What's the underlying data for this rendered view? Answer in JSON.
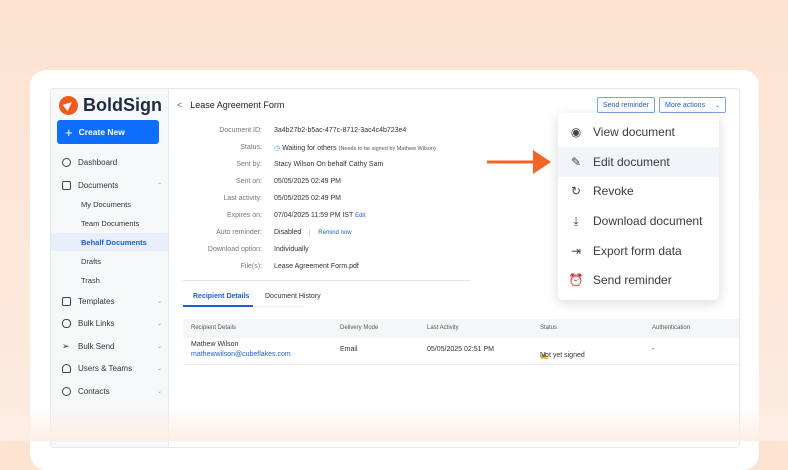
{
  "brand": {
    "name": "BoldSign",
    "accent": "#f25a1d",
    "primary": "#0d6efd"
  },
  "sidebar": {
    "create": "Create New",
    "items": [
      {
        "label": "Dashboard",
        "icon": "dashboard-icon"
      },
      {
        "label": "Documents",
        "icon": "folder-icon"
      },
      {
        "label": "My Documents"
      },
      {
        "label": "Team Documents"
      },
      {
        "label": "Behalf Documents"
      },
      {
        "label": "Drafts"
      },
      {
        "label": "Trash"
      },
      {
        "label": "Templates",
        "icon": "templates-icon"
      },
      {
        "label": "Bulk Links",
        "icon": "link-icon"
      },
      {
        "label": "Bulk Send",
        "icon": "send-icon"
      },
      {
        "label": "Users & Teams",
        "icon": "users-icon"
      },
      {
        "label": "Contacts",
        "icon": "contacts-icon"
      }
    ]
  },
  "header": {
    "title": "Lease Agreement Form",
    "send_reminder": "Send reminder",
    "more_actions": "More actions"
  },
  "details": [
    {
      "label": "Document ID:",
      "value": "3a4b27b2-b5ac-477c-8712-3ac4c4b723e4"
    },
    {
      "label": "Status:",
      "value": "Waiting for others",
      "note": "(Needs to be signed by Mathew Wilson)"
    },
    {
      "label": "Sent by:",
      "value": "Stacy Wilson On behalf Cathy Sam"
    },
    {
      "label": "Sent on:",
      "value": "05/05/2025 02:49 PM"
    },
    {
      "label": "Last activity:",
      "value": "05/05/2025 02:49 PM"
    },
    {
      "label": "Expires on:",
      "value": "07/04/2025 11:59 PM IST",
      "link": "Edit"
    },
    {
      "label": "Auto reminder:",
      "value": "Disabled",
      "link": "Remind now"
    },
    {
      "label": "Download option:",
      "value": "Individually"
    },
    {
      "label": "File(s):",
      "value": "Lease Agreement Form.pdf"
    }
  ],
  "tabs": [
    "Recipient Details",
    "Document History"
  ],
  "table": {
    "headers": [
      "Recipient Details",
      "Delivery Mode",
      "Last Activity",
      "Status",
      "Authentication"
    ],
    "rows": [
      {
        "name": "Mathew Wilson",
        "email": "mathewwilson@cubeflakes.com",
        "mode": "Email",
        "activity": "05/05/2025 02:51 PM",
        "status": "Not yet signed",
        "auth": "-"
      }
    ]
  },
  "menu": [
    {
      "label": "View document",
      "icon": "eye-icon"
    },
    {
      "label": "Edit document",
      "icon": "pencil-icon"
    },
    {
      "label": "Revoke",
      "icon": "revoke-icon"
    },
    {
      "label": "Download document",
      "icon": "download-icon"
    },
    {
      "label": "Export form data",
      "icon": "export-icon"
    },
    {
      "label": "Send reminder",
      "icon": "bell-icon"
    }
  ]
}
